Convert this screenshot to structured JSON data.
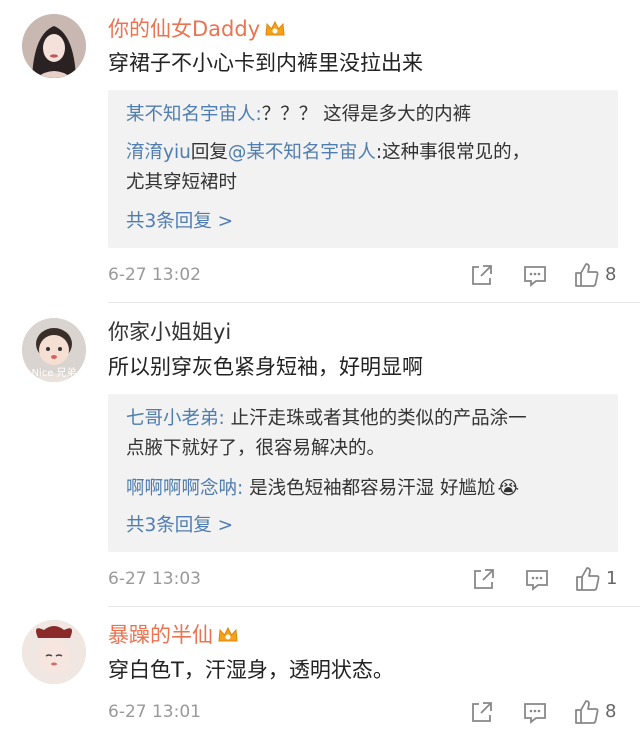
{
  "comments": [
    {
      "username": "你的仙女Daddy",
      "name_color": "#eb7350",
      "vip": true,
      "text": "穿裙子不小心卡到内裤里没拉出来",
      "replies": [
        {
          "name": "某不知名宇宙人:",
          "text": "？？？ 这得是多大的内裤"
        },
        {
          "name": "淯淯yiu",
          "mid": "回复",
          "name2": "@某不知名宇宙人",
          "text": ":这种事很常见的，",
          "text2": "尤其穿短裙时"
        }
      ],
      "more": "共3条回复 >",
      "time": "6-27 13:02",
      "likes": "8"
    },
    {
      "username": "你家小姐姐yi",
      "name_color": "#333333",
      "vip": false,
      "avatar_caption": "Nice 兄弟",
      "text": "所以别穿灰色紧身短袖，好明显啊",
      "replies": [
        {
          "name": "七哥小老弟:",
          "text": " 止汗走珠或者其他的类似的产品涂一",
          "text2": "点腋下就好了，很容易解决的。"
        },
        {
          "name": "啊啊啊啊念呐:",
          "text": " 是浅色短袖都容易汗湿  好尴尬",
          "emoji": "😭"
        }
      ],
      "more": "共3条回复 >",
      "time": "6-27 13:03",
      "likes": "1"
    },
    {
      "username": "暴躁的半仙",
      "name_color": "#eb7350",
      "vip": true,
      "text": "穿白色T，汗湿身，透明状态。",
      "time": "6-27 13:01",
      "likes": "8"
    }
  ],
  "icons": {
    "share": "share-icon",
    "comment": "comment-icon",
    "like": "thumbs-up-icon",
    "vip": "crown-icon"
  },
  "colors": {
    "link_blue": "#507daf",
    "vip_orange": "#eb7350",
    "reply_bg": "#f2f2f2"
  }
}
